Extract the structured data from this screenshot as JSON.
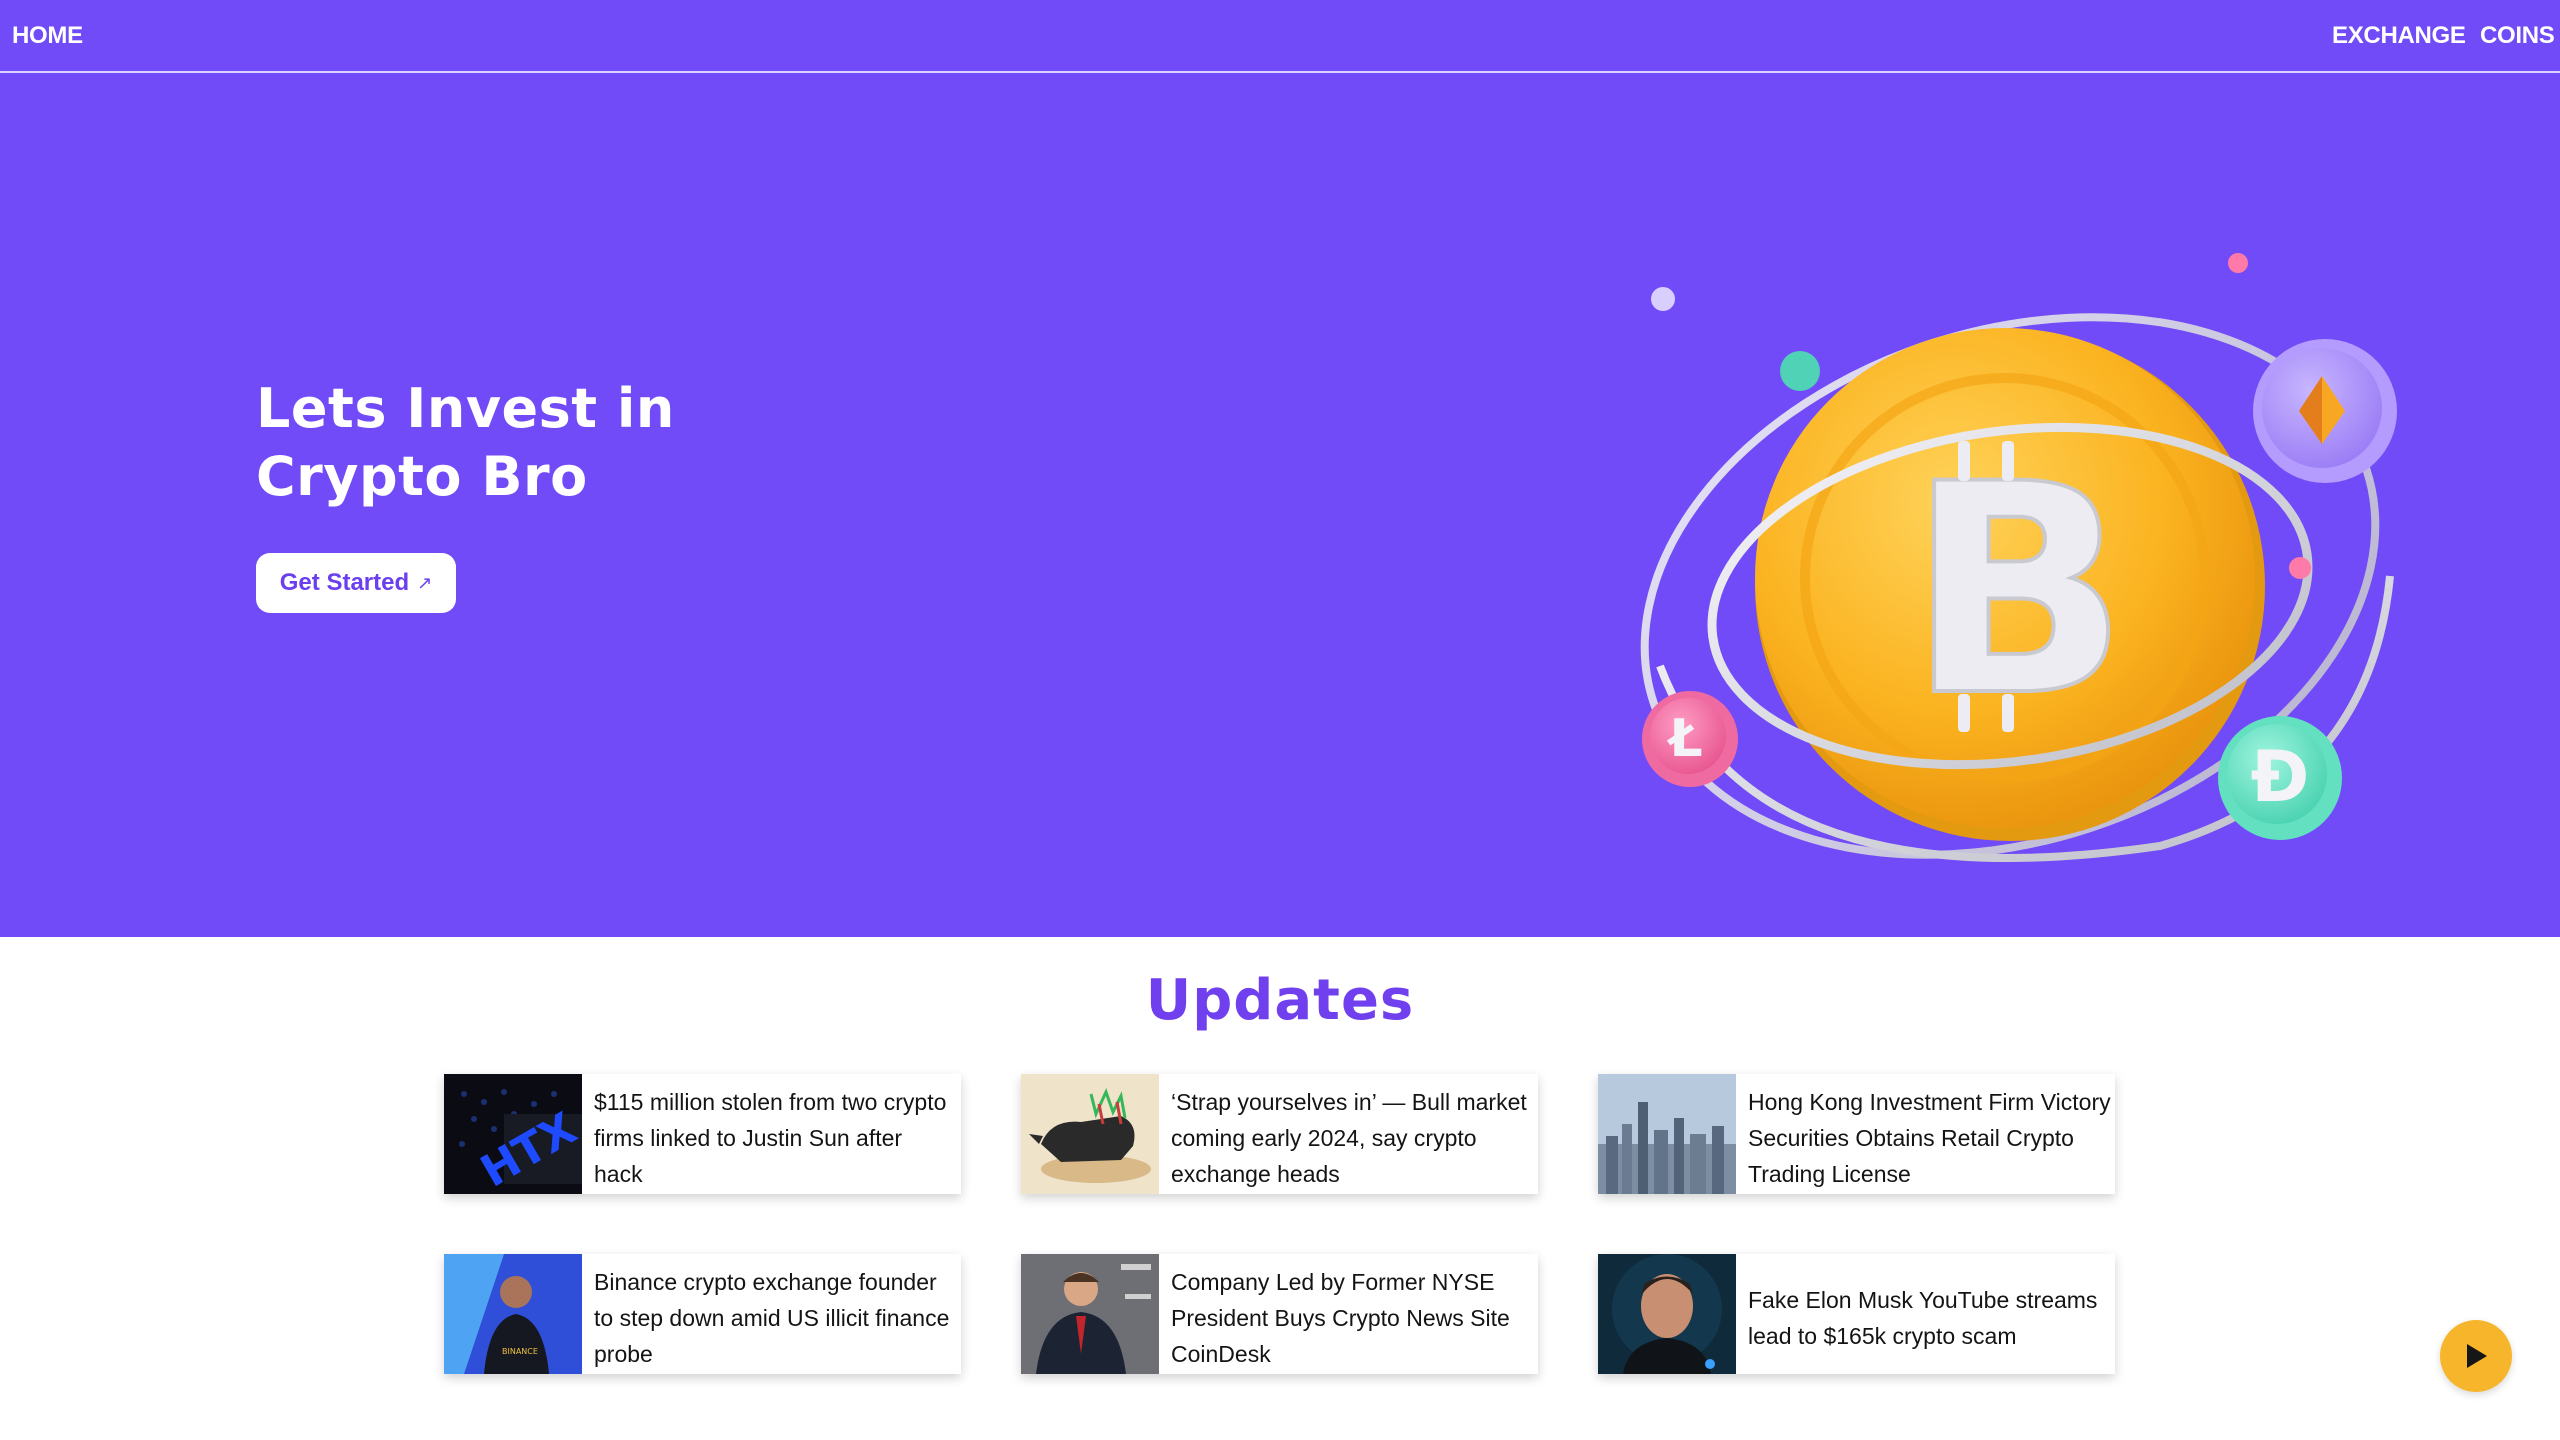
{
  "nav": {
    "home": "HOME",
    "exchange": "EXCHANGE",
    "coins": "COINS"
  },
  "hero": {
    "title": "Lets Invest in Crypto Bro",
    "cta_label": "Get Started",
    "cta_arrow": "↗"
  },
  "updates": {
    "title": "Updates",
    "articles": [
      {
        "headline": "$115 million stolen from two crypto firms linked to Justin Sun after hack"
      },
      {
        "headline": "‘Strap yourselves in’ — Bull market coming early 2024, say crypto exchange heads"
      },
      {
        "headline": "Hong Kong Investment Firm Victory Securities Obtains Retail Crypto Trading License"
      },
      {
        "headline": "Binance crypto exchange founder to step down amid US illicit finance probe"
      },
      {
        "headline": "Company Led by Former NYSE President Buys Crypto News Site CoinDesk"
      },
      {
        "headline": "Fake Elon Musk YouTube streams lead to $165k crypto scam"
      }
    ]
  },
  "colors": {
    "brand": "#714bf7",
    "accent": "#7040ee",
    "bitcoin": "#fbb320",
    "play": "#f7b52b"
  },
  "icons": {
    "cta": "arrow-up-right-icon",
    "play": "play-icon",
    "coins": [
      "bitcoin-icon",
      "ethereum-icon",
      "litecoin-icon",
      "dogecoin-icon"
    ]
  }
}
